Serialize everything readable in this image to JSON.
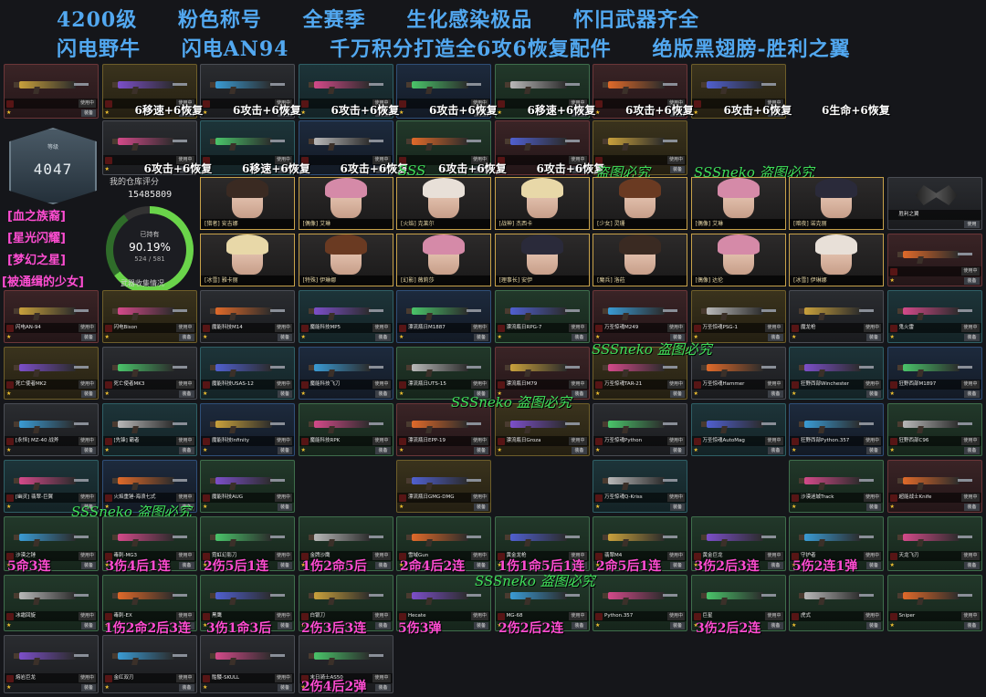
{
  "header": {
    "line1": [
      "4200级",
      "粉色称号",
      "全赛季",
      "生化感染极品",
      "怀旧武器齐全"
    ],
    "line2": [
      "闪电野牛",
      "闪电AN94",
      "千万积分打造全6攻6恢复配件",
      "绝版黑翅膀-胜利之翼"
    ]
  },
  "profile": {
    "level_label": "等级",
    "level": "4047",
    "score_label": "我的仓库评分",
    "score": "15485809",
    "titles": [
      "[血之族裔]",
      "[星光闪耀]",
      "[梦幻之星]",
      "[被通缉的少女]"
    ],
    "owned_label": "已持有",
    "percent": "90.19%",
    "count": "524 / 581",
    "collection_label": "武器收集情况"
  },
  "row1_overlays": [
    "6移速+6恢复",
    "6攻击+6恢复",
    "6攻击+6恢复",
    "6攻击+6恢复",
    "6移速+6恢复",
    "6攻击+6恢复",
    "6攻击+6恢复",
    "6生命+6恢复"
  ],
  "row2_overlays": [
    "6攻击+6恢复",
    "6移速+6恢复",
    "6攻击+6恢复",
    "6攻击+6恢复",
    "6攻击+6恢复"
  ],
  "row2_marks": [
    "SSS",
    "盗图必究",
    "SSSneko 盗图必究"
  ],
  "characters_row1": [
    "[猎者] 安吉娜",
    "[偶像] 艾琳",
    "[火焰] 克莱尔",
    "[战神] 杰西卡",
    "[少女] 灵珊",
    "[偶像] 艾琳",
    "[暗夜] 诺克丽"
  ],
  "characters_row2": [
    "[冰雪] 雅卡丽",
    "[特殊] 伊琳娜",
    "[幻影] 薇莉莎",
    "[理事长] 安伊",
    "[魔兵] 洛菈",
    "[偶像] 达伦",
    "[冰雪] 伊琳娜"
  ],
  "wings_label": "胜利之翼",
  "wings_use": "使用",
  "weapon_rows": [
    [
      "闪电AN-94",
      "闪电Bison",
      "魔能科技M14",
      "魔能科技MP5",
      "漂流瓶日M1887",
      "漂流瓶日RPG-7",
      "万圣惊魂M249",
      "万圣惊魂PSG-1",
      "魔龙枪",
      "鬼火雷"
    ],
    [
      "死亡使者MK2",
      "死亡使者MK3",
      "魔能科技USAS-12",
      "魔能科技飞刀",
      "漂流瓶日UTS-15",
      "漂流瓶日M79",
      "万圣惊魂TAR-21",
      "万圣惊魂Hammer",
      "狂野西部Winchester",
      "狂野西部M1897"
    ],
    [
      "[永恒] MZ-40 战斧",
      "[先锋] 霸者",
      "魔能科技Infinity",
      "魔能科技RPK",
      "漂流瓶日EPP-19",
      "漂流瓶日Groza",
      "万圣惊魂Python",
      "万圣惊魂AutoMag",
      "狂野西部Python.357",
      "狂野西部C96"
    ],
    [
      "[幽灵] 翡翠-巨翼",
      "火焰重锤-海浪七式",
      "魔能科技AUG",
      "",
      "漂流瓶日GMG-DMG",
      "",
      "万圣惊魂Q-Kriss",
      "",
      "沙漠迷城Track",
      "超能战士Knife"
    ]
  ],
  "watermark_a": "SSSneko 盗图必究",
  "row_b1": [
    "沙漠之锤",
    "毒刺-MG3",
    "霓虹幻影刀",
    "金牌沙鹰",
    "雪域Gun",
    "黄金龙枪",
    "翡翠M4",
    "黄金巨龙",
    "守护者",
    "天龙飞刃"
  ],
  "row_b1_overlays": [
    "5命3连",
    "3伤4后1连",
    "2伤5后1连",
    "1伤2命5后",
    "2命4后2连",
    "1伤1命5后1连",
    "2命5后1连",
    "3伤2后3连",
    "5伤2连1弹"
  ],
  "row_b2": [
    "冰霜回旋",
    "毒刺-EX",
    "黑鹰",
    "白银刀",
    "Hecate",
    "MG-68",
    "Python.357",
    "巨星",
    "虎式",
    "Sniper"
  ],
  "row_b2_overlays": [
    "1伤2命2后3连",
    "3伤1命3后",
    "2伤3后3连",
    "5伤3弹",
    "2伤2后2连",
    "3伤2后2连"
  ],
  "row_b3": [
    "熔岩巨龙",
    "金红双刃",
    "骷髅-SKULL",
    "末日骑士AS50"
  ],
  "row_b3_overlays": [
    "2伤4后2弹"
  ],
  "equip_label": "装备",
  "use_label": "使用中"
}
